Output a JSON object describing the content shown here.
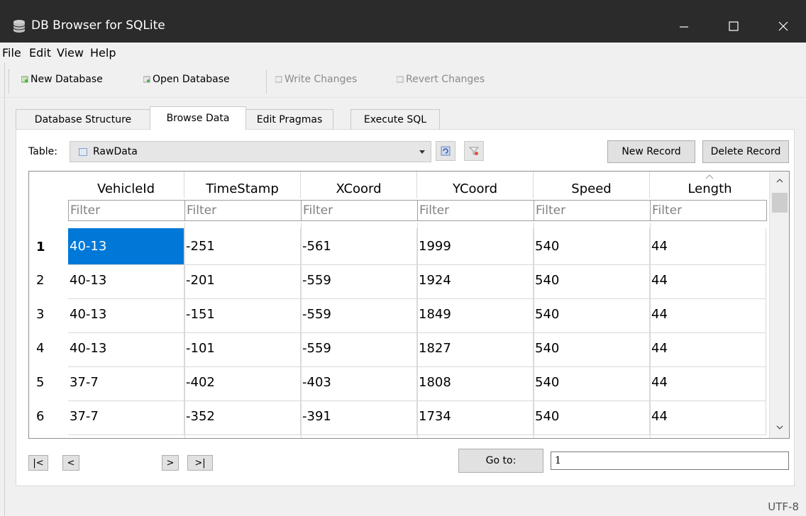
{
  "window": {
    "title": "DB Browser for SQLite"
  },
  "menu": [
    "File",
    "Edit",
    "View",
    "Help"
  ],
  "toolbar": {
    "new_database": "New Database",
    "open_database": "Open Database",
    "write_changes": "Write Changes",
    "revert_changes": "Revert Changes"
  },
  "tabs": [
    "Database Structure",
    "Browse Data",
    "Edit Pragmas",
    "Execute SQL"
  ],
  "active_tab": "Browse Data",
  "browse": {
    "table_label": "Table:",
    "table_value": "RawData",
    "new_record": "New Record",
    "delete_record": "Delete Record"
  },
  "grid": {
    "columns": [
      "VehicleId",
      "TimeStamp",
      "XCoord",
      "YCoord",
      "Speed",
      "Length"
    ],
    "filter_placeholder": "Filter",
    "rows": [
      {
        "num": "1",
        "cells": [
          "40-13",
          "-251",
          "-561",
          "1999",
          "540",
          "44"
        ]
      },
      {
        "num": "2",
        "cells": [
          "40-13",
          "-201",
          "-559",
          "1924",
          "540",
          "44"
        ]
      },
      {
        "num": "3",
        "cells": [
          "40-13",
          "-151",
          "-559",
          "1849",
          "540",
          "44"
        ]
      },
      {
        "num": "4",
        "cells": [
          "40-13",
          "-101",
          "-559",
          "1827",
          "540",
          "44"
        ]
      },
      {
        "num": "5",
        "cells": [
          "37-7",
          "-402",
          "-403",
          "1808",
          "540",
          "44"
        ]
      },
      {
        "num": "6",
        "cells": [
          "37-7",
          "-352",
          "-391",
          "1734",
          "540",
          "44"
        ]
      }
    ]
  },
  "navigation": {
    "first": "|<",
    "prev": "<",
    "next": ">",
    "last": ">|",
    "goto_label": "Go to:",
    "goto_value": "1"
  },
  "status": {
    "encoding": "UTF-8"
  },
  "colors": {
    "selection": "#0078d7",
    "titlebar": "#2b2b2b"
  }
}
